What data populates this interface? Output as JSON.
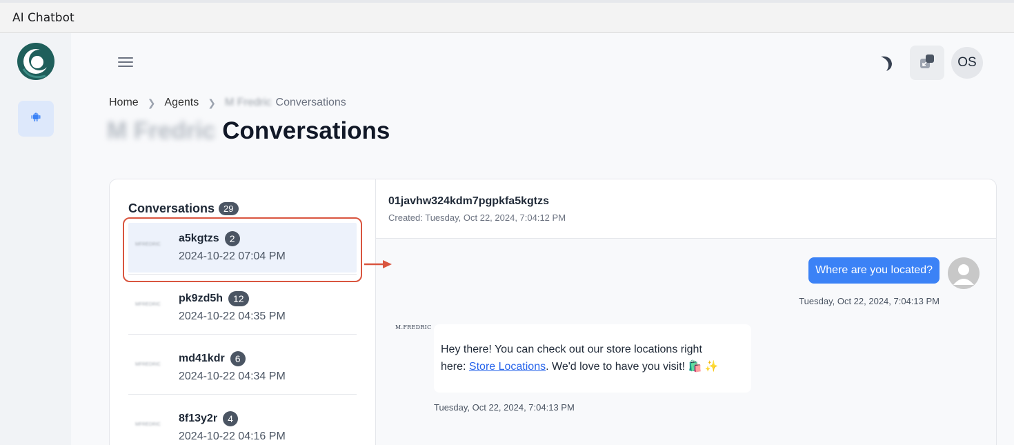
{
  "window": {
    "title": "AI Chatbot"
  },
  "header": {
    "avatar_initials": "OS"
  },
  "breadcrumb": {
    "home": "Home",
    "agents": "Agents",
    "agent_name_blurred": "M Fredric",
    "current": "Conversations"
  },
  "page": {
    "title_blurred": "M Fredric",
    "title": "Conversations"
  },
  "conversations": {
    "heading": "Conversations",
    "count": "29",
    "items": [
      {
        "name": "a5kgtzs",
        "count": "2",
        "date": "2024-10-22 07:04 PM",
        "active": true
      },
      {
        "name": "pk9zd5h",
        "count": "12",
        "date": "2024-10-22 04:35 PM",
        "active": false
      },
      {
        "name": "md41kdr",
        "count": "6",
        "date": "2024-10-22 04:34 PM",
        "active": false
      },
      {
        "name": "8f13y2r",
        "count": "4",
        "date": "2024-10-22 04:16 PM",
        "active": false
      }
    ],
    "thumb_text_blurred": "MFREDRIC"
  },
  "detail": {
    "id": "01javhw324kdm7pgpkfa5kgtzs",
    "created": "Created: Tuesday, Oct 22, 2024, 7:04:12 PM"
  },
  "messages": {
    "user": {
      "text": "Where are you located?",
      "time": "Tuesday, Oct 22, 2024, 7:04:13 PM"
    },
    "bot": {
      "logo_text": "M.FREDRIC",
      "text_line1": "Hey there! You can check out our store locations right",
      "text_before_link": "here: ",
      "link_text": "Store Locations",
      "text_after_link": ". We'd love to have you visit! 🛍️ ✨",
      "time": "Tuesday, Oct 22, 2024, 7:04:13 PM"
    }
  },
  "colors": {
    "accent": "#3b82f6",
    "badge": "#4b5563",
    "annotation": "#d9553f",
    "logo": "#1f5f5b"
  },
  "icons": {
    "menu": "hamburger-icon",
    "theme": "moon-icon",
    "expand": "expand-icon",
    "agent": "android-robot-icon",
    "user_avatar": "user-icon"
  }
}
